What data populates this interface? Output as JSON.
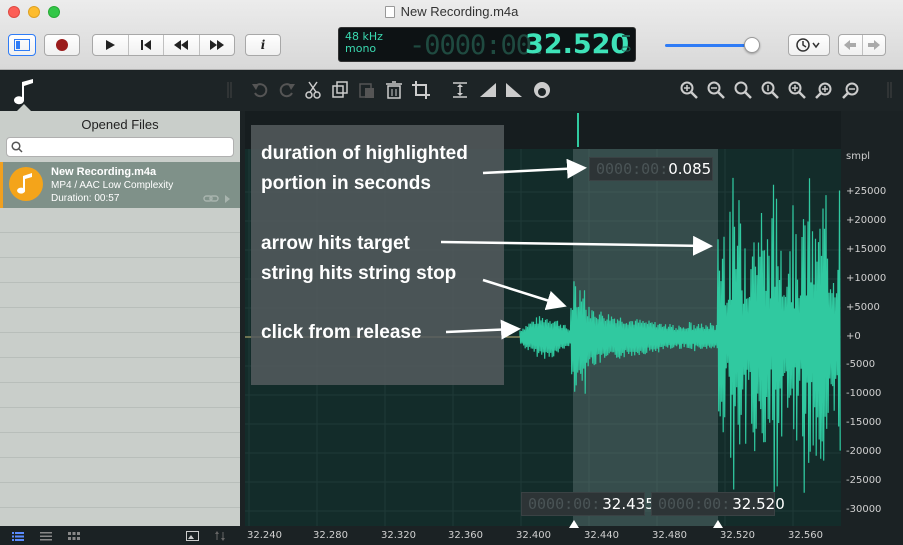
{
  "window": {
    "title": "New Recording.m4a"
  },
  "lcd": {
    "rate": "48 kHz",
    "channels": "mono",
    "time_dim": "-0000:00:",
    "time_bright": "32.520"
  },
  "toolbar": {
    "info_label": "i"
  },
  "volume_slider": {
    "level": 0.9
  },
  "sidebar": {
    "title": "Opened Files",
    "search_placeholder": "",
    "file": {
      "name": "New Recording.m4a",
      "format": "MP4 / AAC Low Complexity",
      "duration": "Duration: 00:57"
    }
  },
  "waveform": {
    "y_unit": "smpl",
    "y_ticks": [
      "+25000",
      "+20000",
      "+15000",
      "+10000",
      "+5000",
      "+0",
      "-5000",
      "-10000",
      "-15000",
      "-20000",
      "-25000",
      "-30000"
    ],
    "x_ticks": [
      "32.240",
      "32.280",
      "32.320",
      "32.360",
      "32.400",
      "32.440",
      "32.480",
      "32.520",
      "32.560"
    ],
    "selection_duration": {
      "dim": "0000:00:",
      "value": "0.085"
    },
    "selection_start": {
      "dim": "0000:00:",
      "value": "32.435"
    },
    "selection_end": {
      "dim": "0000:00:",
      "value": "32.520"
    }
  },
  "annotations": {
    "a1_line1": "duration of highlighted",
    "a1_line2": "portion in seconds",
    "a2": "arrow hits target",
    "a3": "string hits string stop",
    "a4": "click from release"
  },
  "colors": {
    "wave": "#30c9a0",
    "accent": "#3ee2b8",
    "selection": "#3a4a48"
  }
}
